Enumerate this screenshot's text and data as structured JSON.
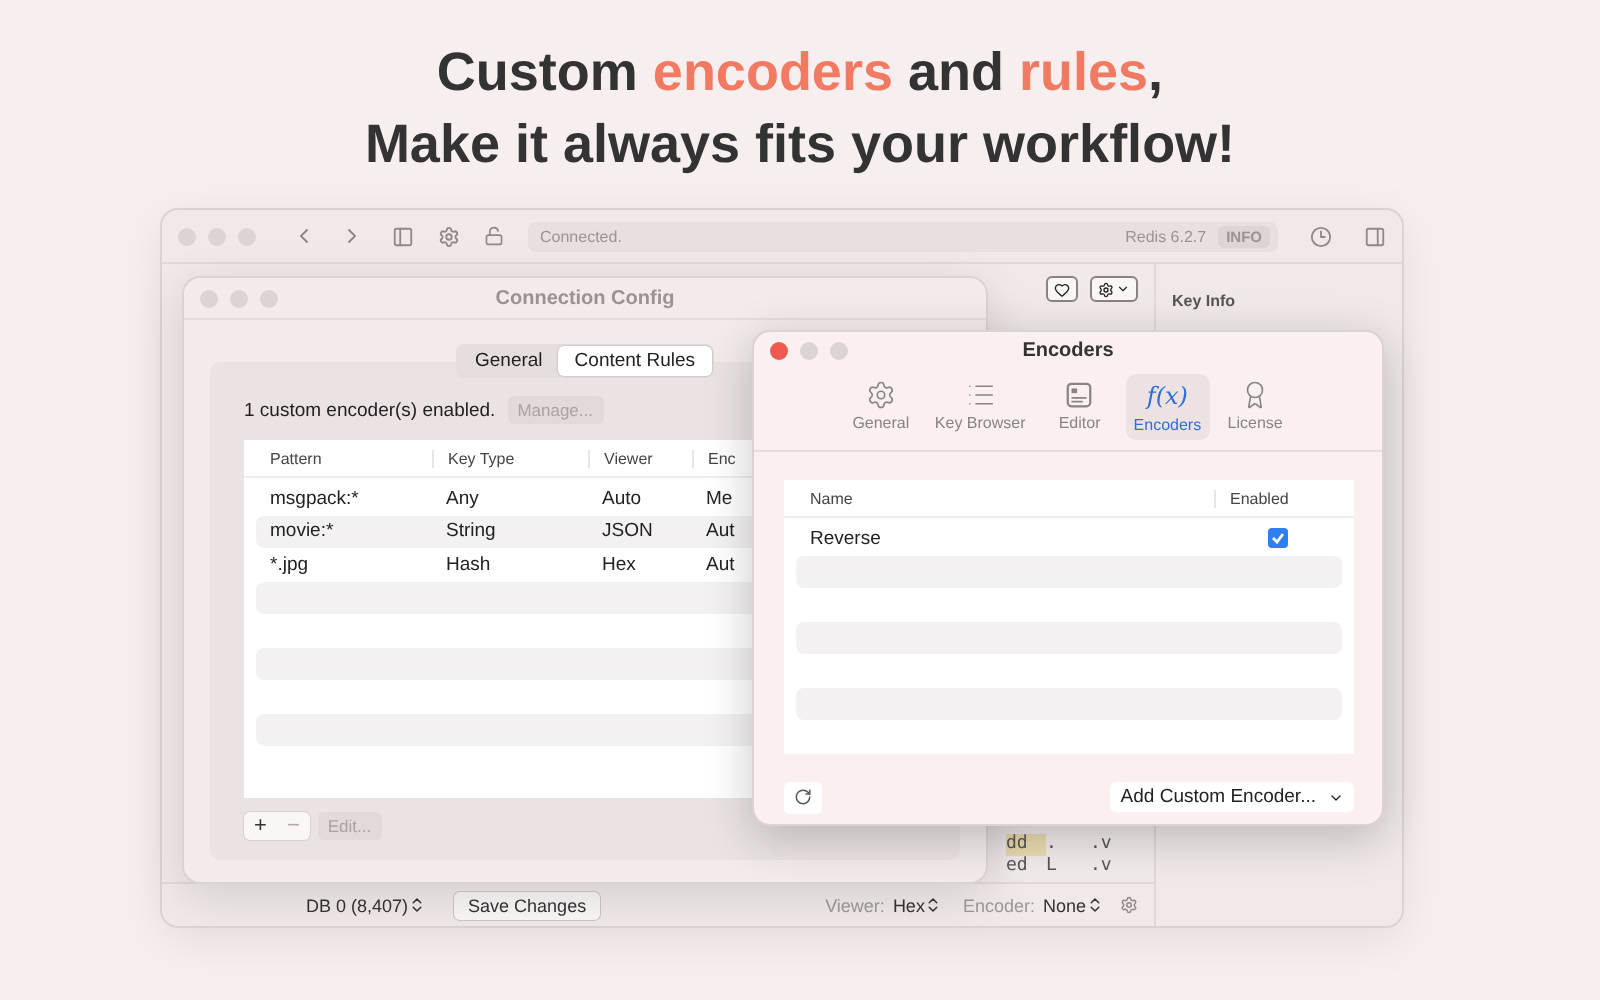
{
  "headline": {
    "lines": [
      [
        {
          "text": "Custom ",
          "accent": false
        },
        {
          "text": "encoders",
          "accent": true
        },
        {
          "text": " and ",
          "accent": false
        },
        {
          "text": "rules",
          "accent": true
        },
        {
          "text": ",",
          "accent": false
        }
      ],
      [
        {
          "text": "Make it always fits your workflow!",
          "accent": false
        }
      ]
    ]
  },
  "main_window": {
    "status": "Connected.",
    "server": "Redis 6.2.7",
    "badge": "INFO",
    "key_info": "Key Info",
    "hex_rows": [
      [
        "dd",
        ".",
        ".v"
      ],
      [
        "ed",
        "L",
        ".v"
      ]
    ],
    "status_bar": {
      "database": "DB 0 (8,407)",
      "save_button": "Save Changes",
      "viewer_label": "Viewer:",
      "viewer": "Hex",
      "encoder_label": "Encoder:",
      "encoder": "None"
    }
  },
  "connection_config": {
    "title": "Connection Config",
    "tabs": [
      {
        "label": "General",
        "selected": false
      },
      {
        "label": "Content Rules",
        "selected": true
      }
    ],
    "summary": "1 custom encoder(s) enabled.",
    "manage_button": {
      "label": "Manage...",
      "disabled": true
    },
    "table": {
      "columns": [
        "Pattern",
        "Key Type",
        "Viewer",
        "Enc"
      ],
      "rows": [
        [
          "msgpack:*",
          "Any",
          "Auto",
          "Me"
        ],
        [
          "movie:*",
          "String",
          "JSON",
          "Aut"
        ],
        [
          "*.jpg",
          "Hash",
          "Hex",
          "Aut"
        ]
      ]
    },
    "add_button": "+",
    "remove_button": "−",
    "edit_button": {
      "label": "Edit...",
      "disabled": true
    }
  },
  "encoders_window": {
    "title": "Encoders",
    "tabs": [
      {
        "label": "General",
        "kind": "gear",
        "selected": false
      },
      {
        "label": "Key Browser",
        "kind": "list",
        "selected": false
      },
      {
        "label": "Editor",
        "kind": "editor",
        "selected": false
      },
      {
        "label": "Encoders",
        "kind": "symbol",
        "symbol": "f(x)",
        "selected": true
      },
      {
        "label": "License",
        "kind": "award",
        "selected": false
      }
    ],
    "table": {
      "columns": [
        "Name",
        "Enabled"
      ],
      "rows": [
        {
          "name": "Reverse",
          "enabled": true
        }
      ]
    },
    "add_button": "Add Custom Encoder..."
  }
}
